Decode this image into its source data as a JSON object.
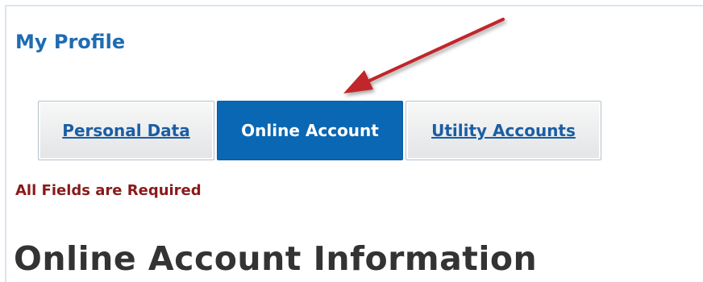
{
  "profile": {
    "title": "My Profile"
  },
  "tabs": [
    {
      "label": "Personal Data",
      "active": false
    },
    {
      "label": "Online Account",
      "active": true
    },
    {
      "label": "Utility Accounts",
      "active": false
    }
  ],
  "form": {
    "required_note": "All Fields are Required",
    "section_heading": "Online Account Information"
  },
  "colors": {
    "title_blue": "#1e6cb3",
    "active_tab": "#0a67b3",
    "link_blue": "#1b5ea3",
    "required_red": "#8a1a1a",
    "annotation_arrow": "#c0262b"
  }
}
